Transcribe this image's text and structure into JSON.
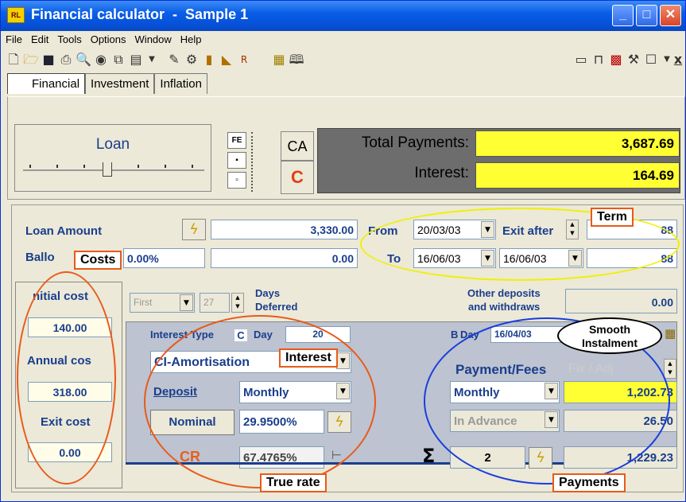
{
  "window": {
    "title": "Financial calculator  -  Sample 1",
    "icon": "RL"
  },
  "menu": [
    "File",
    "Edit",
    "Tools",
    "Options",
    "Window",
    "Help"
  ],
  "tabs": [
    "Financial",
    "Investment",
    "Inflation"
  ],
  "loan": {
    "label": "Loan",
    "fe_label": "FE"
  },
  "summary": {
    "ca": "CA",
    "c": "C",
    "total_label": "Total Payments:",
    "total_value": "3,687.69",
    "interest_label": "Interest:",
    "interest_value": "164.69"
  },
  "main": {
    "loan_amount_label": "Loan Amount",
    "loan_amount": "3,330.00",
    "balloon_label": "Ballo",
    "balloon_pct": "0.00%",
    "balloon_value": "0.00",
    "from_label": "From",
    "from_date": "20/03/03",
    "exit_after_label": "Exit after",
    "exit_after_value": "88",
    "to_label": "To",
    "to_date": "16/06/03",
    "to_date2": "16/06/03",
    "to_value": "88"
  },
  "costs": {
    "initial_label": "nitial cost",
    "initial_value": "140.00",
    "annual_label": "Annual cos",
    "annual_value": "318.00",
    "exit_label": "Exit cost",
    "exit_value": "0.00"
  },
  "deferred": {
    "first": "First",
    "days_value": "27",
    "days_label": "Days",
    "deferred_label": "Deferred",
    "other_label1": "Other deposits",
    "other_label2": "and withdraws",
    "other_value": "0.00"
  },
  "interest": {
    "type_label": "Interest Type",
    "c_label": "C",
    "day_label": "Day",
    "day_value": "20",
    "method": "CI-Amortisation",
    "deposit_label": "Deposit",
    "deposit_value": "Monthly",
    "nominal_label": "Nominal",
    "nominal_value": "29.9500%",
    "cr_label": "CR",
    "cr_value": "67.4765%"
  },
  "payments": {
    "b_label": "B",
    "day_label": "Day",
    "day_value": "16/04/03",
    "fees_label": "Payment/Fees",
    "fix_adj": "Fix / Adj",
    "freq": "Monthly",
    "instalment": "1,202.73",
    "advance": "In Advance",
    "fee_value": "26.50",
    "count": "2",
    "total": "1,229.23",
    "sigma": "Σ"
  },
  "annotations": {
    "costs": "Costs",
    "term": "Term",
    "interest": "Interest",
    "smooth1": "Smooth",
    "smooth2": "Instalment",
    "true_rate": "True rate",
    "payments": "Payments"
  }
}
